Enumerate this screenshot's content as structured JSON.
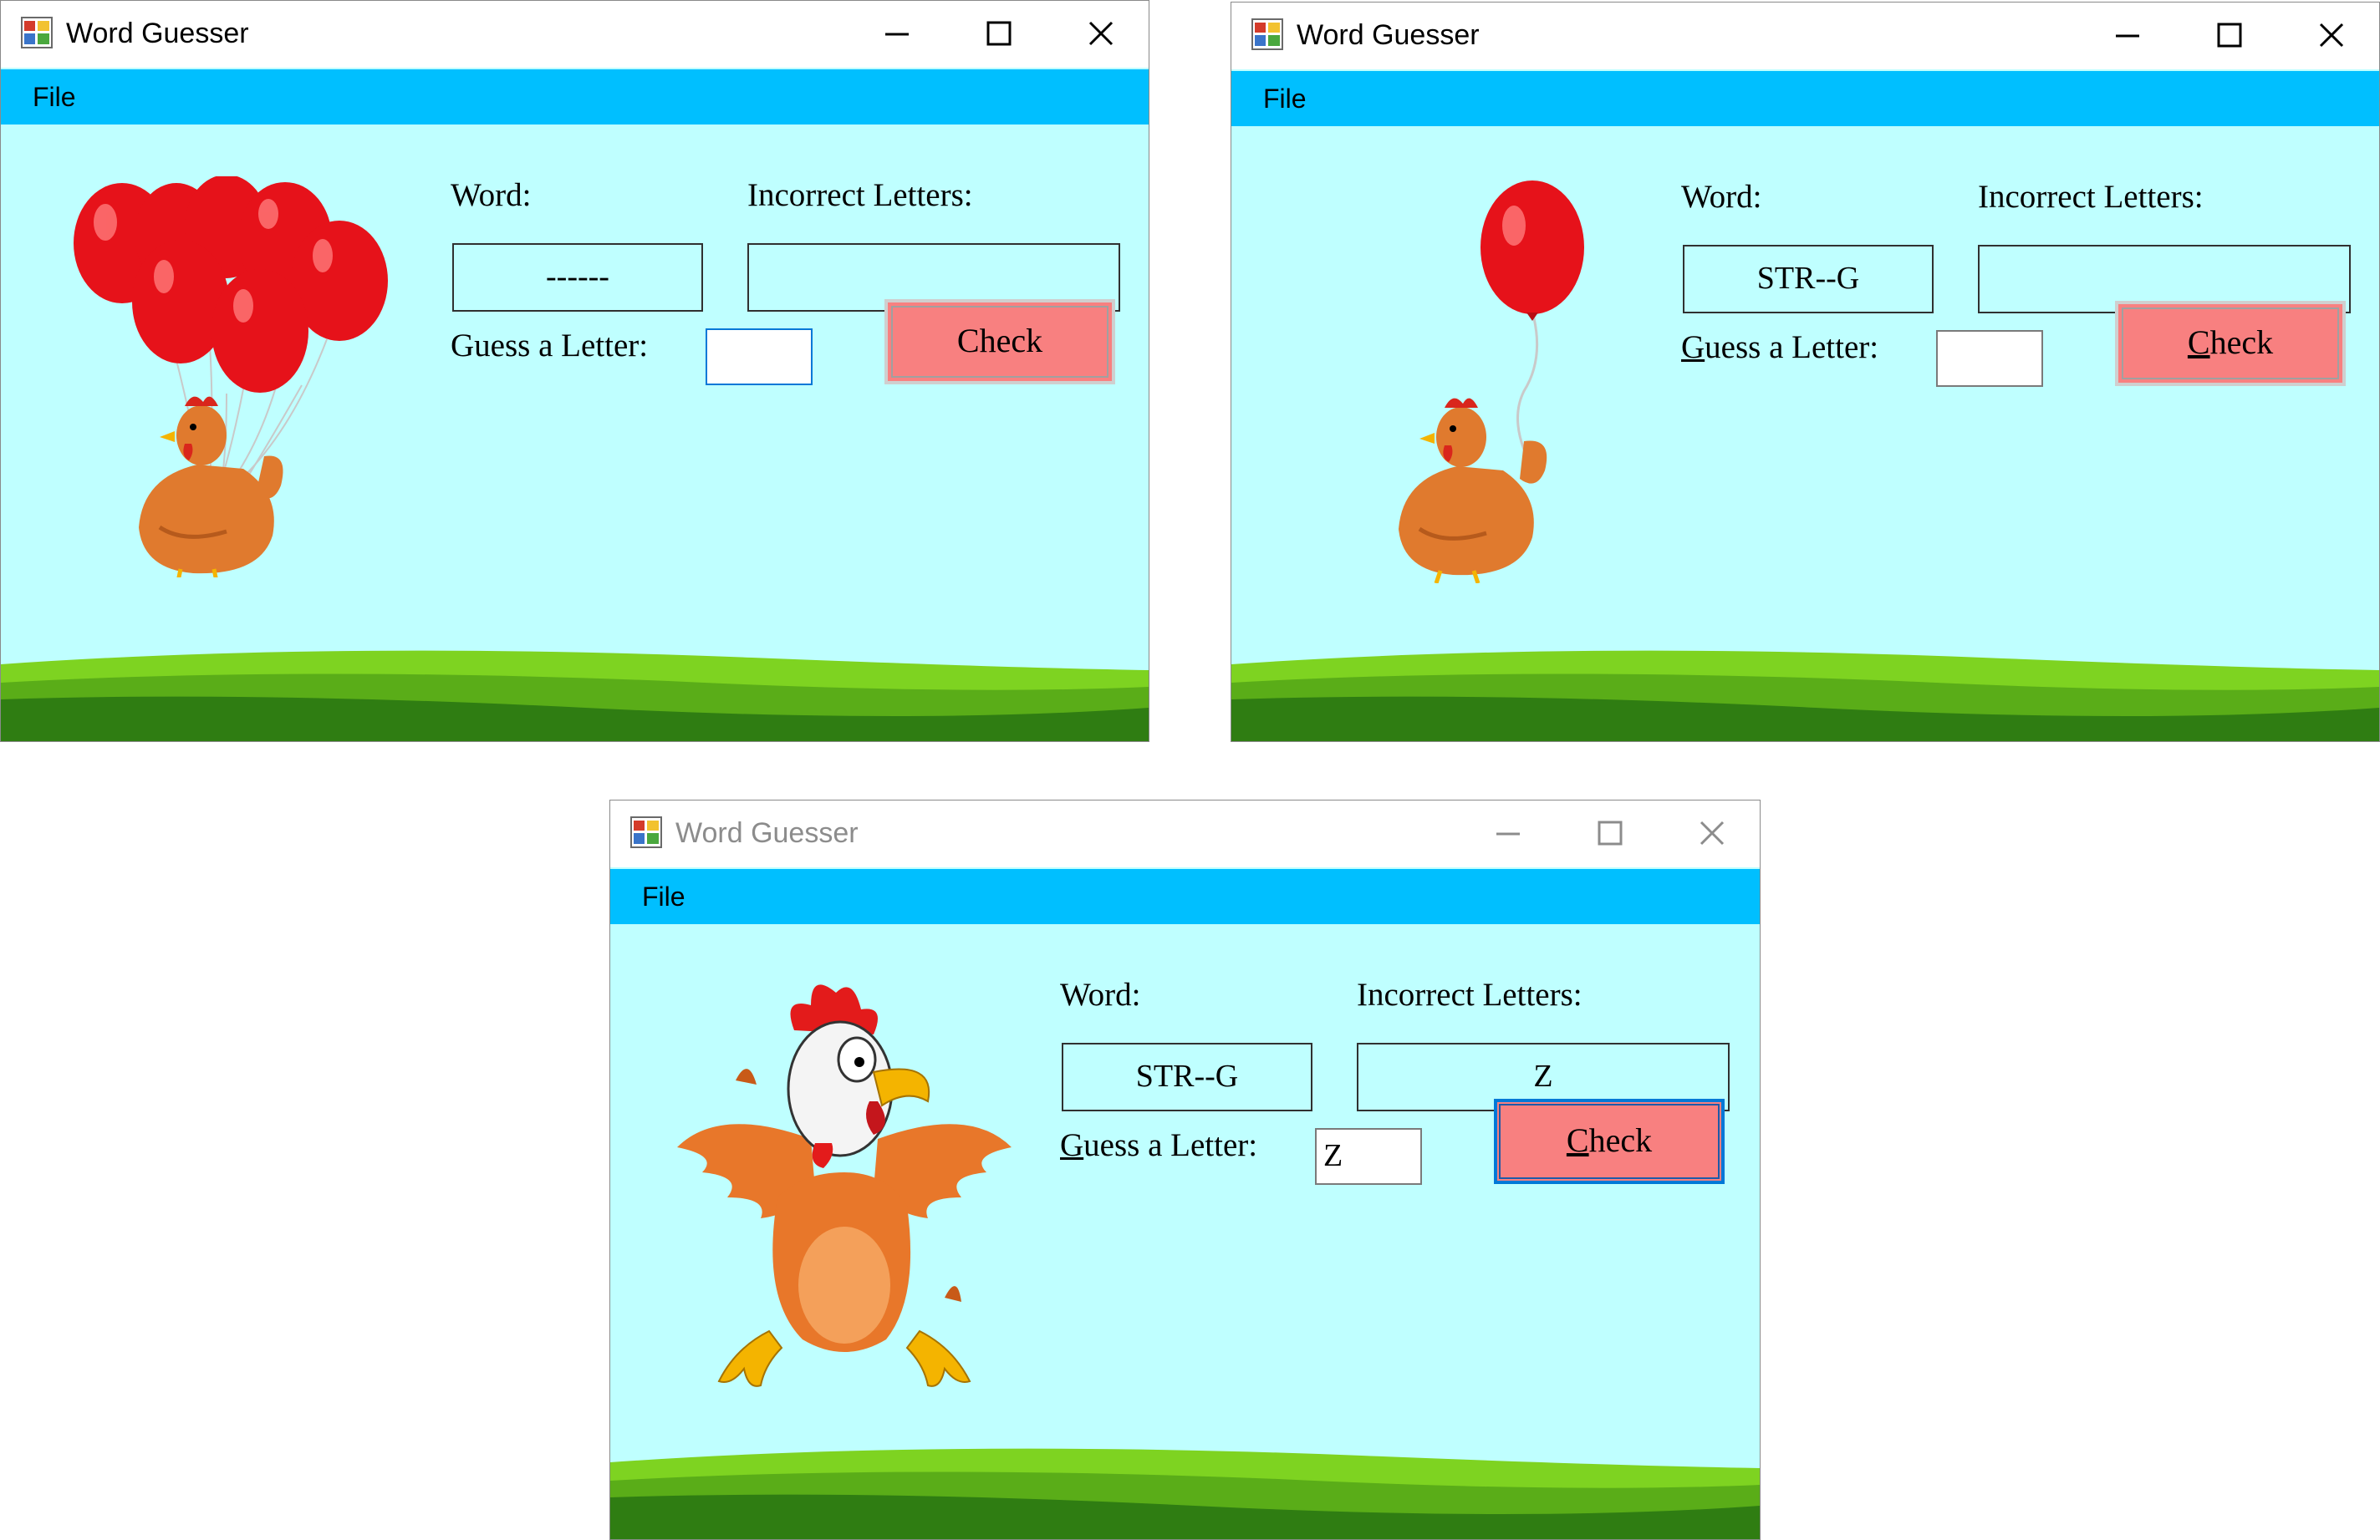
{
  "colors": {
    "client_bg": "#bfffff",
    "menu_bg": "#00bfff",
    "check_button": "#f88080",
    "grass_light": "#7ed321",
    "grass_dark": "#2f7d12"
  },
  "windows": [
    {
      "title": "Word Guesser",
      "active": true,
      "menu": {
        "file": "File"
      },
      "labels": {
        "word": "Word:",
        "incorrect": "Incorrect Letters:",
        "guess": "Guess a Letter:"
      },
      "word_value": "------",
      "incorrect_value": "",
      "guess_value": "",
      "check_label": "Check",
      "illustration": "chicken-with-many-balloons"
    },
    {
      "title": "Word Guesser",
      "active": true,
      "menu": {
        "file": "File"
      },
      "labels": {
        "word": "Word:",
        "incorrect": "Incorrect Letters:",
        "guess": "Guess a Letter:"
      },
      "word_value": "STR--G",
      "incorrect_value": "",
      "guess_value": "",
      "check_label": "Check",
      "illustration": "chicken-with-one-balloon"
    },
    {
      "title": "Word Guesser",
      "active": false,
      "menu": {
        "file": "File"
      },
      "labels": {
        "word": "Word:",
        "incorrect": "Incorrect Letters:",
        "guess": "Guess a Letter:"
      },
      "word_value": "STR--G",
      "incorrect_value": "Z",
      "guess_value": "Z",
      "check_label": "Check",
      "illustration": "falling-chicken"
    }
  ]
}
